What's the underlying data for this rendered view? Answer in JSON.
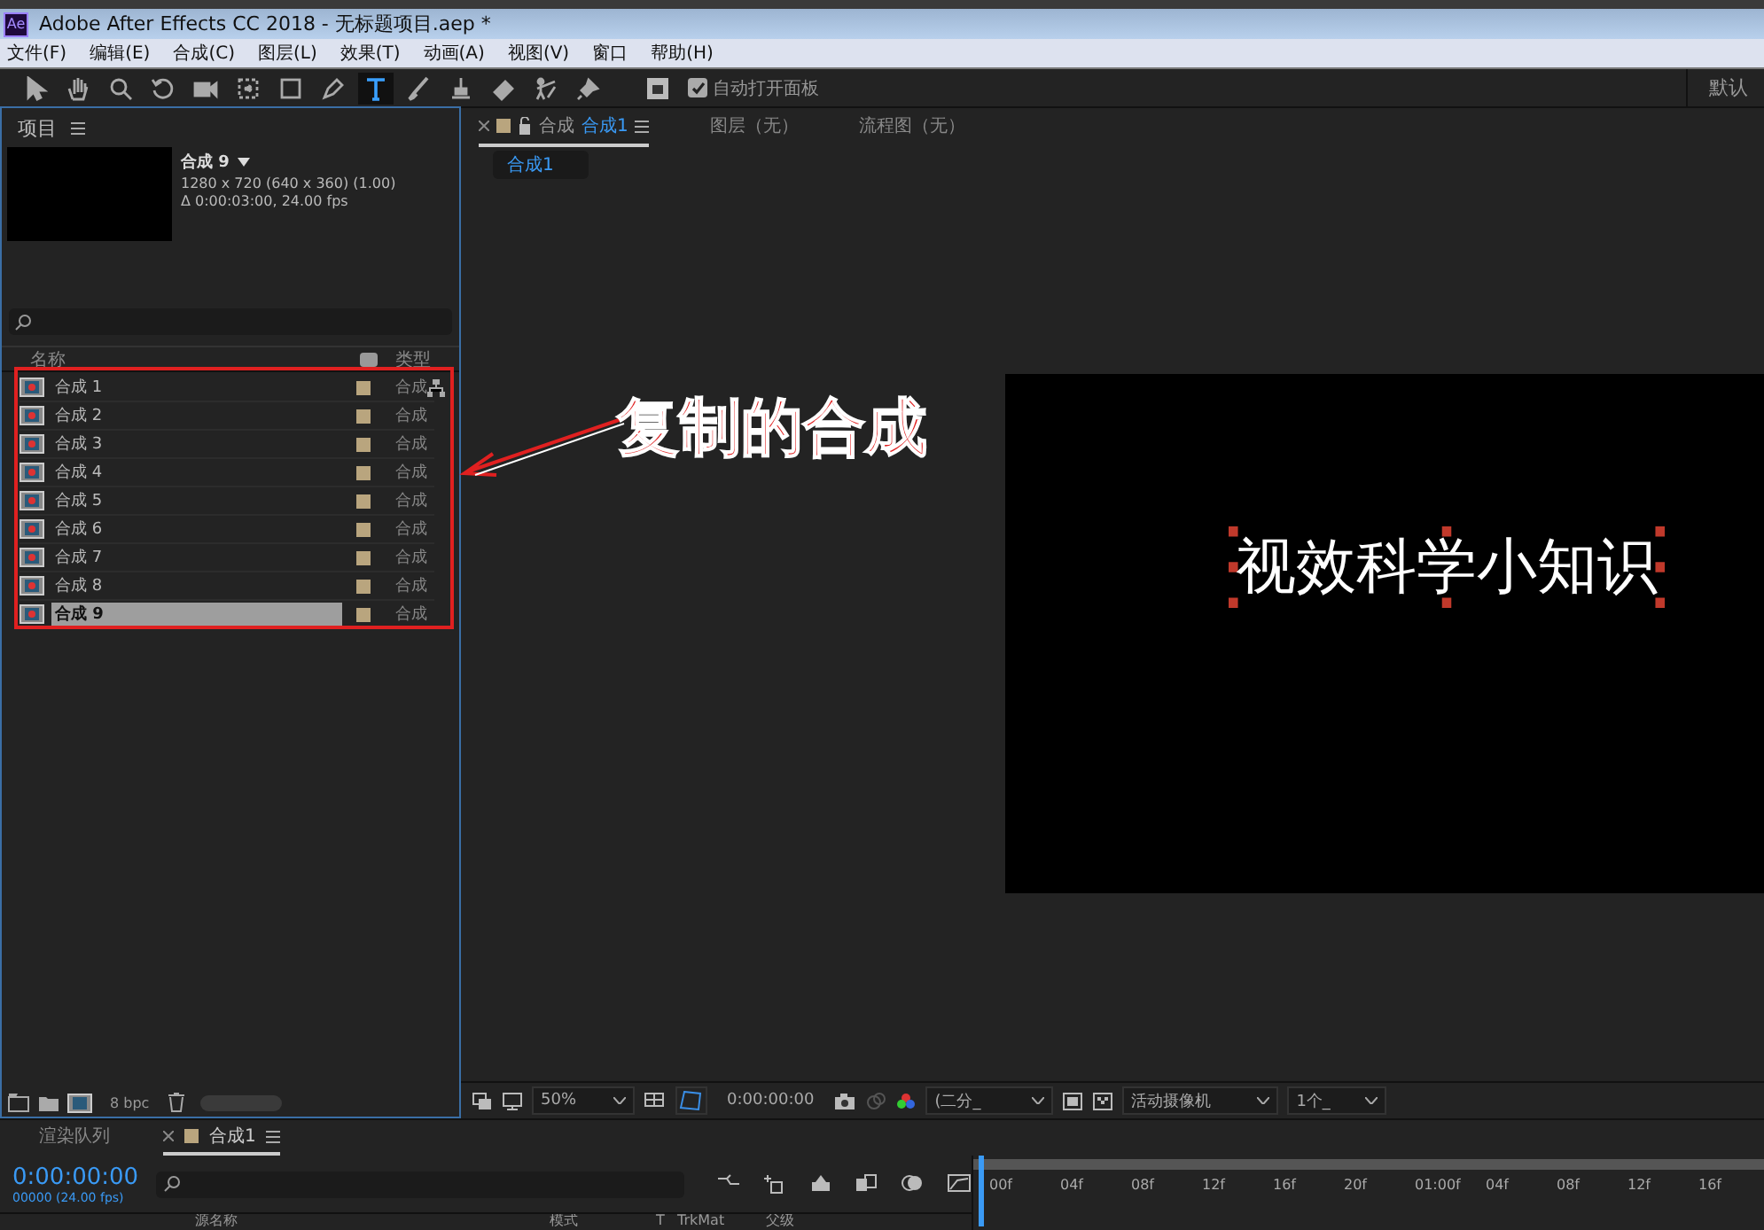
{
  "window": {
    "app_icon": "Ae",
    "title": "Adobe After Effects CC 2018 - 无标题项目.aep *"
  },
  "menu": [
    "文件(F)",
    "编辑(E)",
    "合成(C)",
    "图层(L)",
    "效果(T)",
    "动画(A)",
    "视图(V)",
    "窗口",
    "帮助(H)"
  ],
  "toolbar": {
    "tools": [
      {
        "kind": "select",
        "selected": false
      },
      {
        "kind": "hand",
        "selected": false
      },
      {
        "kind": "zoom",
        "selected": false
      },
      {
        "kind": "rotate",
        "selected": false
      },
      {
        "kind": "camera",
        "selected": false
      },
      {
        "kind": "pan",
        "selected": false
      },
      {
        "kind": "rect",
        "selected": false
      },
      {
        "kind": "pen",
        "selected": false
      },
      {
        "kind": "text",
        "selected": true
      },
      {
        "kind": "brush",
        "selected": false
      },
      {
        "kind": "stamp",
        "selected": false
      },
      {
        "kind": "eraser",
        "selected": false
      },
      {
        "kind": "roto",
        "selected": false
      },
      {
        "kind": "pin",
        "selected": false
      }
    ],
    "auto_open": {
      "label": "自动打开面板",
      "checked": true
    },
    "workspace": "默认"
  },
  "project": {
    "title": "项目",
    "preview": {
      "name": "合成 9",
      "size": "1280 x 720  (640 x 360) (1.00)",
      "duration": "Δ 0:00:03:00, 24.00 fps"
    },
    "columns": [
      "名称",
      "类型"
    ],
    "items": [
      {
        "name": "合成 1",
        "type": "合成",
        "selected": false
      },
      {
        "name": "合成 2",
        "type": "合成",
        "selected": false
      },
      {
        "name": "合成 3",
        "type": "合成",
        "selected": false
      },
      {
        "name": "合成 4",
        "type": "合成",
        "selected": false
      },
      {
        "name": "合成 5",
        "type": "合成",
        "selected": false
      },
      {
        "name": "合成 6",
        "type": "合成",
        "selected": false
      },
      {
        "name": "合成 7",
        "type": "合成",
        "selected": false
      },
      {
        "name": "合成 8",
        "type": "合成",
        "selected": false
      },
      {
        "name": "合成 9",
        "type": "合成",
        "selected": true
      }
    ],
    "bpc": "8 bpc"
  },
  "annotation": {
    "text": "复制的合成"
  },
  "viewer": {
    "tabs": [
      {
        "prefix": "合成",
        "label": "合成1",
        "selected": true
      },
      {
        "label": "图层（无）",
        "selected": false
      },
      {
        "label": "流程图（无）",
        "selected": false
      }
    ],
    "breadcrumb": "合成1",
    "canvas_text": "视效科学小知识",
    "footer": {
      "zoom": "50%",
      "time": "0:00:00:00",
      "resolution": "(二分_",
      "camera": "活动摄像机",
      "views": "1个_"
    }
  },
  "timeline": {
    "tabs": [
      {
        "label": "渲染队列",
        "selected": false
      },
      {
        "label": "合成1",
        "selected": true
      }
    ],
    "time": "0:00:00:00",
    "frames": "00000 (24.00 fps)",
    "ruler": [
      "00f",
      "04f",
      "08f",
      "12f",
      "16f",
      "20f",
      "01:00f",
      "04f",
      "08f",
      "12f",
      "16f"
    ],
    "columns": [
      "源名称",
      "模式",
      "T",
      "TrkMat",
      "父级"
    ]
  }
}
